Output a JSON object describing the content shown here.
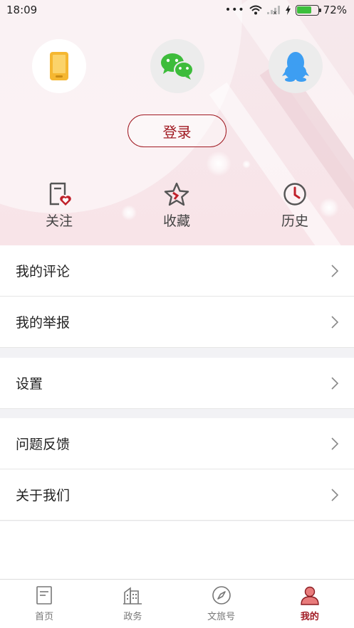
{
  "status_bar": {
    "time": "18:09",
    "battery_percent": "72%",
    "battery_level": 0.72
  },
  "login": {
    "providers": [
      {
        "name": "phone-icon",
        "color": "#f5b731"
      },
      {
        "name": "wechat-icon",
        "color": "#3dbc3b"
      },
      {
        "name": "qq-icon",
        "color": "#3d9ef2"
      }
    ],
    "button_label": "登录"
  },
  "quick_links": [
    {
      "icon": "follow-icon",
      "label": "关注"
    },
    {
      "icon": "star-icon",
      "label": "收藏"
    },
    {
      "icon": "clock-icon",
      "label": "历史"
    }
  ],
  "menu": {
    "group1": [
      "我的评论",
      "我的举报"
    ],
    "group2": [
      "设置"
    ],
    "group3": [
      "问题反馈",
      "关于我们"
    ]
  },
  "tabbar": {
    "tabs": [
      {
        "icon": "document-icon",
        "label": "首页"
      },
      {
        "icon": "building-icon",
        "label": "政务"
      },
      {
        "icon": "compass-icon",
        "label": "文旅号"
      },
      {
        "icon": "user-icon",
        "label": "我的",
        "active": true
      }
    ]
  },
  "colors": {
    "accent": "#a01a22",
    "hero_bg": "#f7e6ea",
    "active_user_icon": "#e87b7b"
  }
}
